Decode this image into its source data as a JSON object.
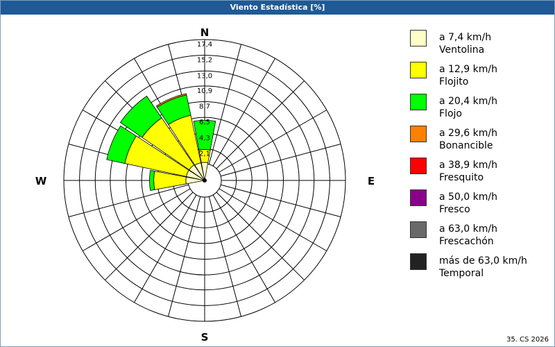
{
  "window": {
    "title": "Viento Estadística [%]"
  },
  "footer": {
    "text": "35. CS 2026"
  },
  "compass": {
    "n": "N",
    "e": "E",
    "s": "S",
    "w": "W"
  },
  "legend": [
    {
      "value": "a 7,4 km/h",
      "name": "Ventolina",
      "color": "#ffffc8"
    },
    {
      "value": "a 12,9 km/h",
      "name": "Flojito",
      "color": "#ffff00"
    },
    {
      "value": "a 20,4 km/h",
      "name": "Flojo",
      "color": "#00ff00"
    },
    {
      "value": "a 29,6 km/h",
      "name": "Bonancible",
      "color": "#ff8000"
    },
    {
      "value": "a 38,9 km/h",
      "name": "Fresquito",
      "color": "#ff0000"
    },
    {
      "value": "a 50,0 km/h",
      "name": "Fresco",
      "color": "#8b008b"
    },
    {
      "value": "a 63,0 km/h",
      "name": "Frescachón",
      "color": "#696969"
    },
    {
      "value": "más de 63,0 km/h",
      "name": "Temporal",
      "color": "#222222"
    }
  ],
  "chart_data": {
    "type": "polar-stacked-bar",
    "rmax": 17.4,
    "rings": [
      2.1,
      4.3,
      6.5,
      8.7,
      10.9,
      13.0,
      15.2,
      17.4
    ],
    "ring_labels": [
      "2,1",
      "4,3",
      "6,5",
      "8,7",
      "10,9",
      "13,0",
      "15,2",
      "17,4"
    ],
    "directions": [
      "N",
      "NNE",
      "NE",
      "ENE",
      "E",
      "ESE",
      "SE",
      "SSE",
      "S",
      "SSW",
      "SW",
      "WSW",
      "W",
      "WNW",
      "NW",
      "NNW"
    ],
    "angles_deg": [
      0,
      22.5,
      45,
      67.5,
      90,
      112.5,
      135,
      157.5,
      180,
      202.5,
      225,
      247.5,
      270,
      292.5,
      315,
      337.5
    ],
    "series": [
      {
        "name": "Ventolina",
        "values": [
          0.2,
          0,
          0,
          0,
          0,
          0,
          0,
          0,
          0,
          0,
          0,
          0,
          0.3,
          0.3,
          0.3,
          0.2
        ]
      },
      {
        "name": "Flojito",
        "values": [
          1.8,
          0,
          0,
          0,
          0,
          0,
          0,
          0,
          0,
          0,
          0,
          0,
          4.5,
          8.8,
          8.0,
          6.8
        ]
      },
      {
        "name": "Flojo",
        "values": [
          4.1,
          0,
          0,
          0,
          0,
          0,
          0,
          0,
          0,
          0,
          0,
          0,
          0.6,
          2.6,
          3.7,
          2.9
        ]
      },
      {
        "name": "Bonancible",
        "values": [
          0,
          0,
          0,
          0,
          0,
          0,
          0,
          0,
          0,
          0,
          0,
          0,
          0,
          0,
          0,
          0.2
        ]
      },
      {
        "name": "Fresquito",
        "values": [
          0,
          0,
          0,
          0,
          0,
          0,
          0,
          0,
          0,
          0,
          0,
          0,
          0,
          0,
          0,
          0
        ]
      },
      {
        "name": "Fresco",
        "values": [
          0,
          0,
          0,
          0,
          0,
          0,
          0,
          0,
          0,
          0,
          0,
          0,
          0,
          0,
          0,
          0
        ]
      },
      {
        "name": "Frescachón",
        "values": [
          0,
          0,
          0,
          0,
          0,
          0,
          0,
          0,
          0,
          0,
          0,
          0,
          0,
          0,
          0,
          0
        ]
      },
      {
        "name": "Temporal",
        "values": [
          0,
          0,
          0,
          0,
          0,
          0,
          0,
          0,
          0,
          0,
          0,
          0,
          0,
          0,
          0,
          0
        ]
      }
    ],
    "grid": true,
    "legend_position": "right"
  }
}
